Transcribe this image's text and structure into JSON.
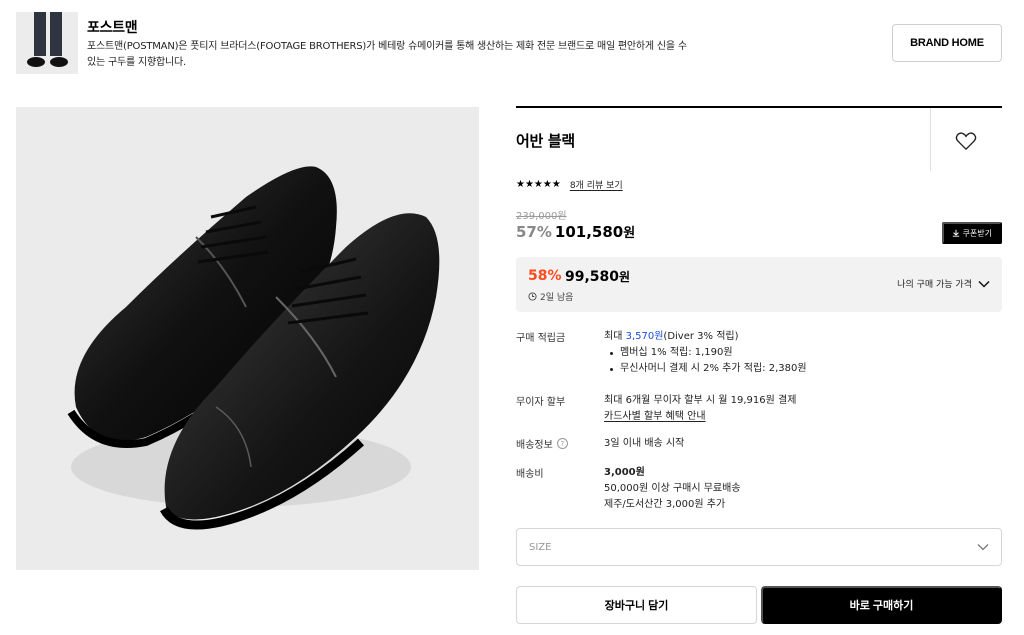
{
  "brand": {
    "name": "포스트맨",
    "description": "포스트맨(POSTMAN)은 풋티지 브라더스(FOOTAGE BROTHERS)가 베테랑 슈메이커를 통해 생산하는 제화 전문 브랜드로 매일 편안하게 신을 수 있는 구두를 지향합니다.",
    "home_button": "BRAND HOME"
  },
  "product": {
    "title": "어반 블랙",
    "stars": "★★★★★",
    "review_link": "8개 리뷰 보기",
    "original_price": "239,000원",
    "discount_rate": "57%",
    "price": "101,580",
    "price_unit": "원",
    "coupon_button": "쿠폰받기"
  },
  "best_price": {
    "rate": "58%",
    "price": "99,580",
    "unit": "원",
    "timer": "2일 남음",
    "toggle_label": "나의 구매 가능 가격"
  },
  "details": {
    "points": {
      "label": "구매 적립금",
      "prefix": "최대 ",
      "amount": "3,570원",
      "suffix": "(Diver 3% 적립)",
      "bullets": [
        "멤버십 1% 적립: 1,190원",
        "무신사머니 결제 시 2% 추가 적립: 2,380원"
      ]
    },
    "installment": {
      "label": "무이자 할부",
      "text": "최대 6개월 무이자 할부 시 월 19,916원 결제",
      "link": "카드사별 할부 혜택 안내"
    },
    "shipping_info": {
      "label": "배송정보",
      "help": "?",
      "text": "3일 이내 배송 시작"
    },
    "shipping_fee": {
      "label": "배송비",
      "fee": "3,000원",
      "line2": "50,000원 이상 구매시 무료배송",
      "line3": "제주/도서산간 3,000원 추가"
    }
  },
  "size_select": {
    "placeholder": "SIZE"
  },
  "actions": {
    "cart": "장바구니 담기",
    "buy": "바로 구매하기"
  },
  "icons": {
    "heart": "heart-outline-icon",
    "download": "download-icon",
    "clock": "clock-icon",
    "chevron": "chevron-down-icon"
  },
  "colors": {
    "discount_orange": "#ff4b1f",
    "points_blue": "#1d4ed8",
    "primary": "#000000"
  }
}
